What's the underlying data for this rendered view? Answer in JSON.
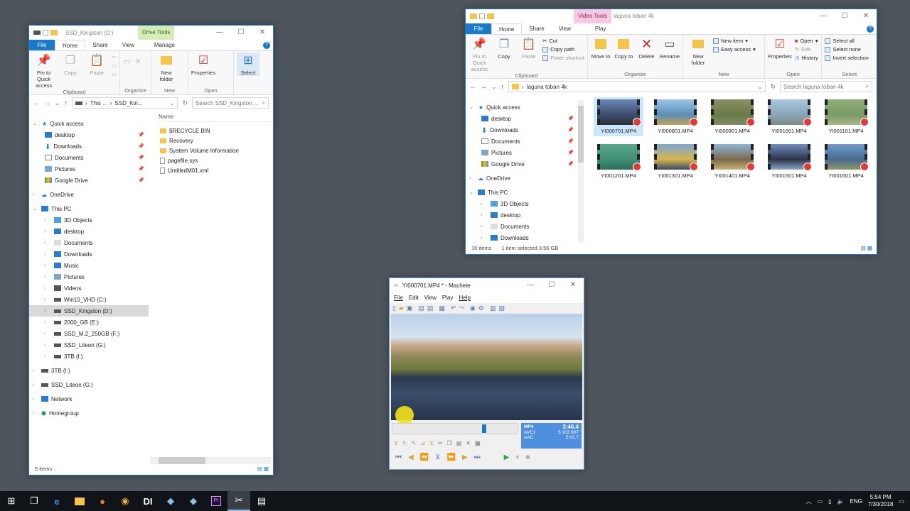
{
  "left_explorer": {
    "title": "SSD_Kingston (D:)",
    "context_tab": "Drive Tools",
    "tabs": [
      "File",
      "Home",
      "Share",
      "View",
      "Manage"
    ],
    "ribbon": {
      "clipboard": {
        "pin": "Pin to Quick access",
        "copy": "Copy",
        "paste": "Paste",
        "name": "Clipboard"
      },
      "organize": {
        "name": "Organize"
      },
      "new": {
        "new_folder": "New folder",
        "name": "New"
      },
      "open": {
        "properties": "Properties",
        "name": "Open"
      },
      "select": {
        "select": "Select"
      }
    },
    "address": {
      "segments": [
        "This ...",
        "SSD_Kin..."
      ],
      "search_placeholder": "Search SSD_Kingston ..."
    },
    "column_header": "Name",
    "files": [
      "$RECYCLE.BIN",
      "Recovery",
      "System Volume Information",
      "pagefile.sys",
      "UntitledM01.xml"
    ],
    "nav": {
      "quick_access": "Quick access",
      "quick_items": [
        "desktop",
        "Downloads",
        "Documents",
        "Pictures",
        "Google Drive"
      ],
      "onedrive": "OneDrive",
      "this_pc": "This PC",
      "pc_items": [
        "3D Objects",
        "desktop",
        "Documents",
        "Downloads",
        "Music",
        "Pictures",
        "Videos",
        "Win10_VHD (C:)",
        "SSD_Kingston (D:)",
        "2000_GB (E:)",
        "SSD_M.2_250GB (F:)",
        "SSD_Liteon (G:)",
        "3TB (I:)"
      ],
      "extra": [
        "3TB (I:)",
        "SSD_Liteon (G:)",
        "Network",
        "Homegroup"
      ]
    },
    "status": "5 items"
  },
  "right_explorer": {
    "context_tab": "Video Tools",
    "title": "laguna toban 4k",
    "tabs": [
      "File",
      "Home",
      "Share",
      "View",
      "Play"
    ],
    "ribbon": {
      "clipboard": {
        "pin": "Pin to Quick access",
        "copy": "Copy",
        "paste": "Paste",
        "cut": "Cut",
        "copy_path": "Copy path",
        "paste_shortcut": "Paste shortcut",
        "name": "Clipboard"
      },
      "organize": {
        "move_to": "Move to",
        "copy_to": "Copy to",
        "delete": "Delete",
        "rename": "Rename",
        "name": "Organize"
      },
      "new": {
        "new_folder": "New folder",
        "new_item": "New item",
        "easy_access": "Easy access",
        "name": "New"
      },
      "open": {
        "properties": "Properties",
        "open": "Open",
        "edit": "Edit",
        "history": "History",
        "name": "Open"
      },
      "select": {
        "select_all": "Select all",
        "select_none": "Select none",
        "invert": "Invert selection",
        "name": "Select"
      }
    },
    "address": {
      "path": "laguna toban 4k",
      "search_placeholder": "Search laguna toban 4k"
    },
    "nav": {
      "quick_access": "Quick access",
      "quick_items": [
        "desktop",
        "Downloads",
        "Documents",
        "Pictures",
        "Google Drive"
      ],
      "onedrive": "OneDrive",
      "this_pc": "This PC",
      "pc_items": [
        "3D Objects",
        "desktop",
        "Documents",
        "Downloads"
      ]
    },
    "files": [
      "YI000701.MP4",
      "YI000801.MP4",
      "YI000901.MP4",
      "YI001001.MP4",
      "YI001101.MP4",
      "YI001201.MP4",
      "YI001301.MP4",
      "YI001401.MP4",
      "YI001501.MP4",
      "YI001601.MP4"
    ],
    "status": {
      "count": "10 items",
      "selection": "1 item selected  3.56 GB"
    }
  },
  "machete": {
    "title": "YI000701.MP4 * - Machete",
    "menu": [
      "File",
      "Edit",
      "View",
      "Play",
      "Help"
    ],
    "info": {
      "format": "MP4",
      "time": "3:46.4",
      "video": "AVC1",
      "size": "5 103 807",
      "audio": "AAC",
      "duration": "5:01.7"
    }
  },
  "taskbar": {
    "lang": "ENG",
    "time": "5:54 PM",
    "date": "7/30/2018"
  }
}
